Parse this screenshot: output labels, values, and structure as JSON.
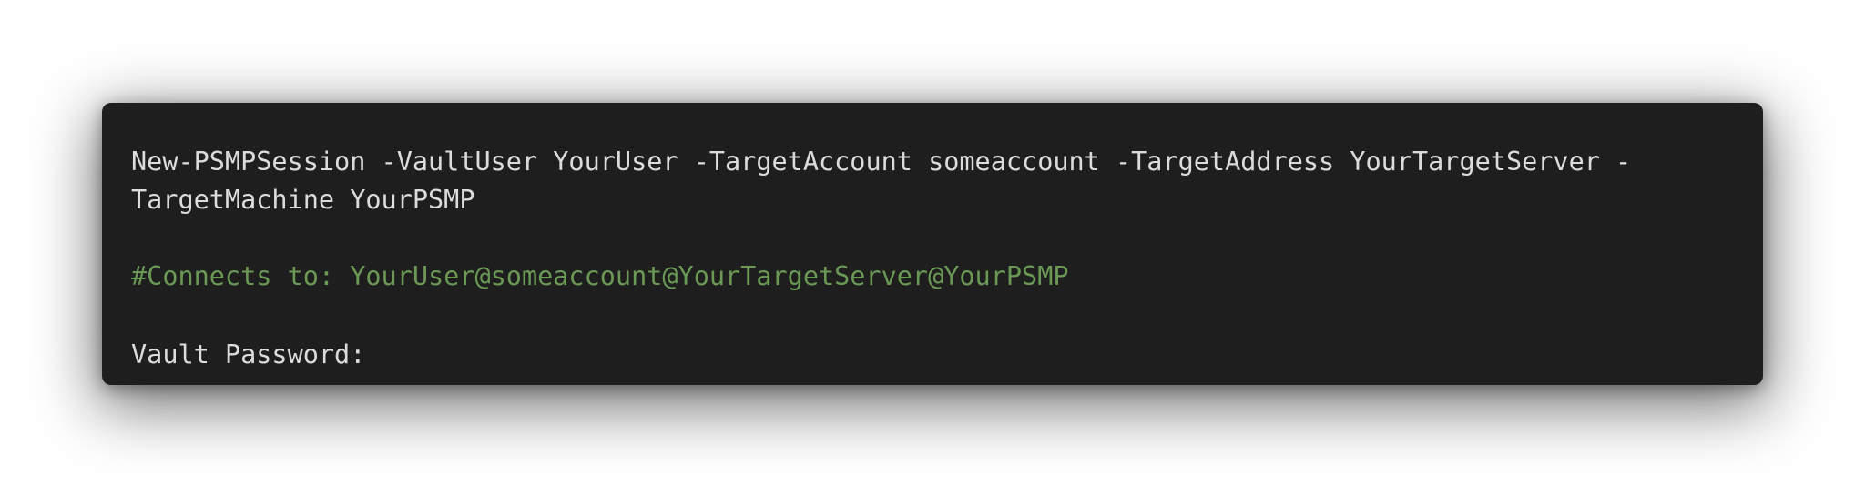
{
  "terminal": {
    "command_line_1": "New-PSMPSession -VaultUser YourUser -TargetAccount someaccount -TargetAddress YourTargetServer -",
    "command_line_2": "TargetMachine YourPSMP",
    "comment": "#Connects to: YourUser@someaccount@YourTargetServer@YourPSMP",
    "prompt": "Vault Password:"
  },
  "colors": {
    "background": "#1e1e1e",
    "text": "#dcdcdc",
    "comment": "#6a9955"
  }
}
